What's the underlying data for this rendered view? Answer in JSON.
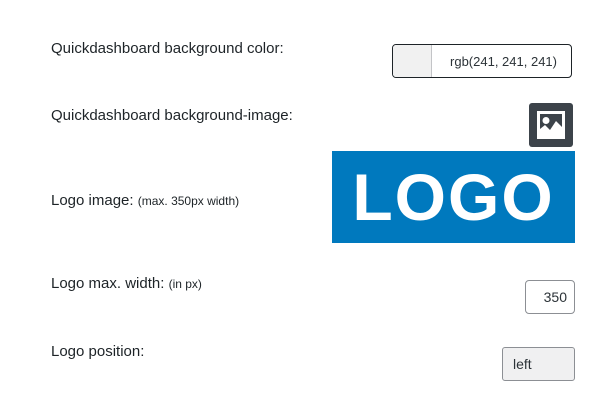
{
  "settings": {
    "bg_color": {
      "label": "Quickdashboard background color:",
      "value": "rgb(241, 241, 241)",
      "swatch": "#f1f1f1"
    },
    "bg_image": {
      "label": "Quickdashboard background-image:",
      "icon": "image-icon"
    },
    "logo_image": {
      "label": "Logo image:",
      "hint": "(max. 350px width)",
      "logo_text": "LOGO",
      "logo_bg": "#0079be"
    },
    "logo_width": {
      "label": "Logo max. width:",
      "hint": "(in px)",
      "value": "350"
    },
    "logo_position": {
      "label": "Logo position:",
      "value": "left"
    }
  }
}
